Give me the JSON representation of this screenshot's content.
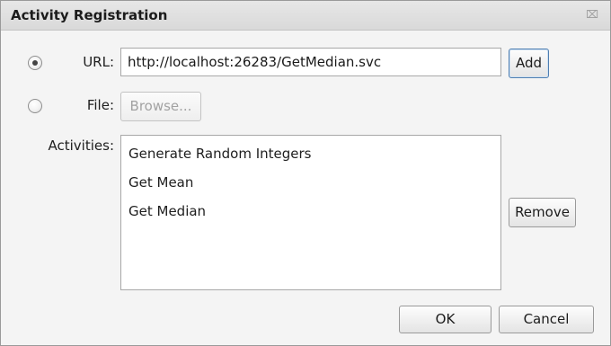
{
  "dialog": {
    "title": "Activity Registration",
    "close_glyph": "⌧"
  },
  "url_row": {
    "label": "URL:",
    "value": "http://localhost:26283/GetMedian.svc",
    "selected": true,
    "add_label": "Add"
  },
  "file_row": {
    "label": "File:",
    "selected": false,
    "browse_label": "Browse..."
  },
  "activities": {
    "label": "Activities:",
    "items": [
      "Generate Random Integers",
      "Get Mean",
      "Get Median"
    ],
    "remove_label": "Remove"
  },
  "footer": {
    "ok_label": "OK",
    "cancel_label": "Cancel"
  }
}
